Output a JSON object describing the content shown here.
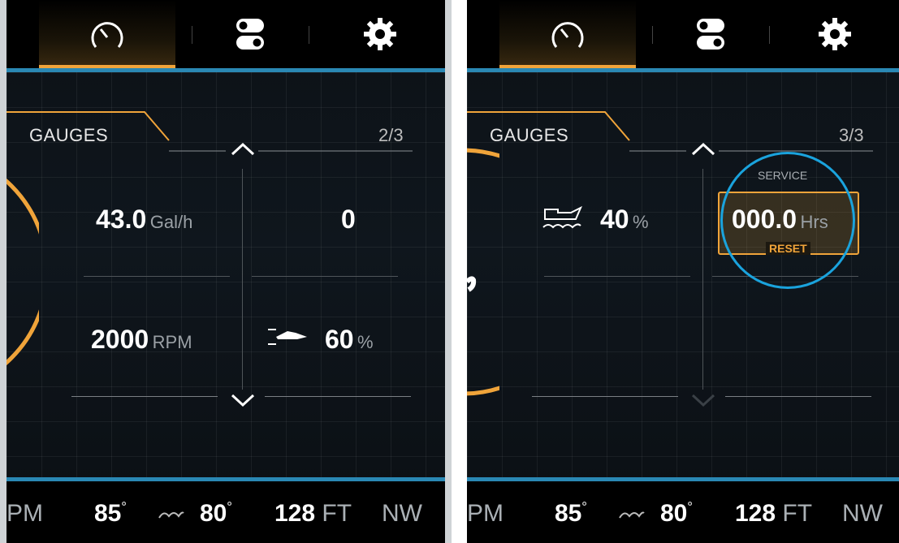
{
  "screens": [
    {
      "page": "2/3",
      "section": "GAUGES",
      "fuel_rate": {
        "value": "43.0",
        "unit": "Gal/h"
      },
      "top_right_value": "0",
      "rpm": {
        "value": "2000",
        "unit": "RPM"
      },
      "trim": {
        "value": "60",
        "unit": "%"
      }
    },
    {
      "page": "3/3",
      "section": "GAUGES",
      "oil": {
        "value": "40",
        "unit": "%"
      },
      "service": {
        "title": "SERVICE",
        "value": "000.0",
        "unit": "Hrs",
        "reset": "RESET"
      }
    }
  ],
  "bottombar": {
    "rpm_label": "PM",
    "temp1": "85",
    "temp2": "80",
    "depth": "128",
    "depth_unit": "FT",
    "heading": "NW",
    "degree": "°"
  },
  "icons": [
    "speedometer-icon",
    "toggle-switches-icon",
    "gear-icon",
    "chevron-up-icon",
    "chevron-down-icon",
    "trim-boat-icon",
    "oil-can-icon",
    "water-temp-icon"
  ],
  "colors": {
    "accent_orange": "#f0a43a",
    "accent_blue": "#2a88b4",
    "highlight_ring": "#1aa3dd"
  }
}
